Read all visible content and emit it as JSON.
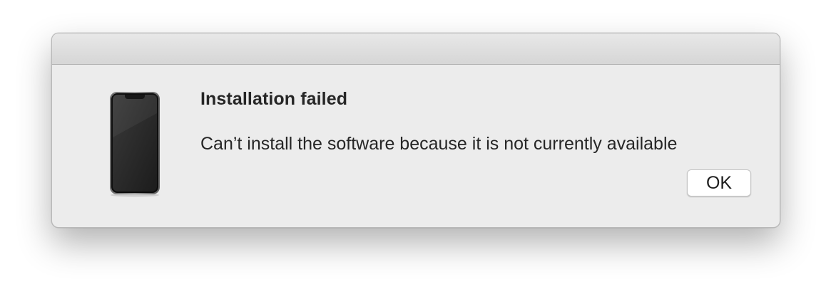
{
  "dialog": {
    "title": "Installation failed",
    "message": "Can’t install the software because it is not currently available",
    "ok_label": "OK",
    "icon": "iphone-icon"
  },
  "colors": {
    "window_background": "#ececec",
    "titlebar_top": "#e8e8e8",
    "titlebar_bottom": "#d6d6d6",
    "text": "#262626",
    "button_background": "#ffffff"
  }
}
